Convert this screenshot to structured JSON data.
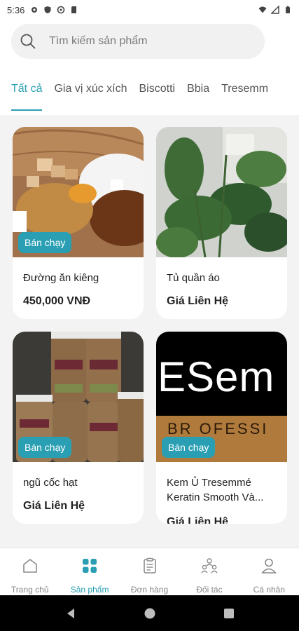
{
  "status_bar": {
    "time": "5:36"
  },
  "search": {
    "placeholder": "Tìm kiếm sản phẩm"
  },
  "tabs": [
    {
      "label": "Tất cả",
      "active": true
    },
    {
      "label": "Gia vị xúc xích"
    },
    {
      "label": "Biscotti"
    },
    {
      "label": "Bbia"
    },
    {
      "label": "Tresemm"
    }
  ],
  "products": [
    {
      "name": "Đường ăn kiêng",
      "price": "450,000 VNĐ",
      "badge": "Bán chạy"
    },
    {
      "name": "Tủ quần áo",
      "price": "Giá Liên Hệ"
    },
    {
      "name": "ngũ cốc hạt",
      "price": "Giá Liên Hệ",
      "badge": "Bán chạy"
    },
    {
      "name": "Kem Ủ Tresemmé Keratin Smooth Và...",
      "price": "Giá Liên Hệ",
      "badge": "Bán chạy",
      "image_text": "ESem",
      "image_subtext": "BR OFESSI"
    }
  ],
  "bottom_nav": [
    {
      "label": "Trang chủ"
    },
    {
      "label": "Sản phẩm",
      "active": true
    },
    {
      "label": "Đơn hàng"
    },
    {
      "label": "Đối tác"
    },
    {
      "label": "Cá nhân"
    }
  ],
  "colors": {
    "accent": "#2a9fb3",
    "background": "#f3f3f3",
    "card": "#ffffff"
  }
}
